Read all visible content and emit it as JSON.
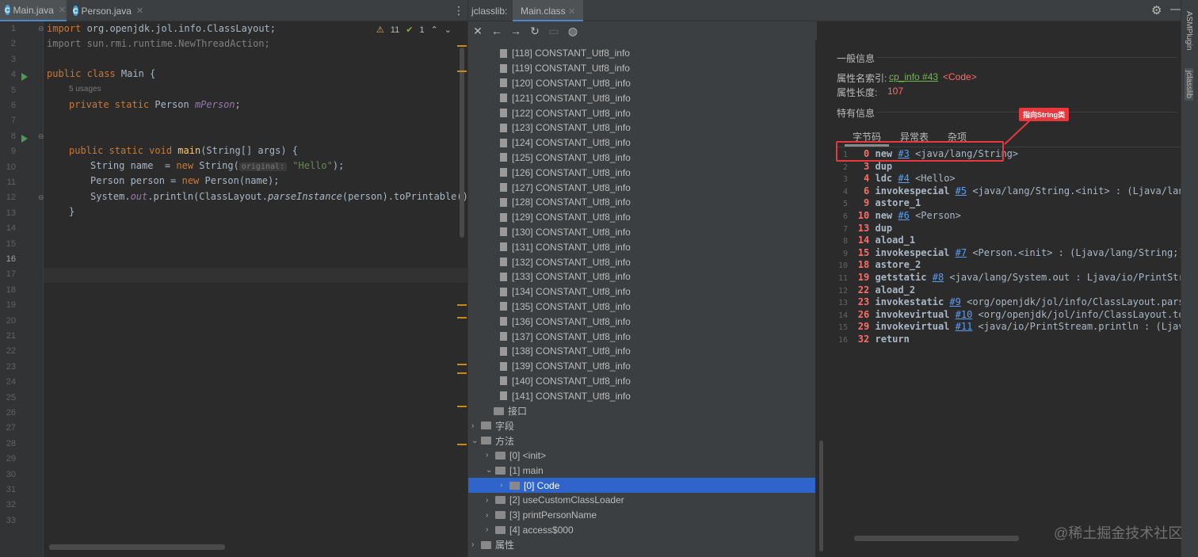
{
  "editor": {
    "tabs": [
      {
        "label": "Main.java",
        "icon": "java-class-icon"
      },
      {
        "label": "Person.java",
        "icon": "java-class-icon"
      }
    ],
    "inspection": {
      "warnings": "11",
      "ok": "1"
    },
    "line_numbers": [
      "1",
      "2",
      "3",
      "4",
      "5",
      "6",
      "7",
      "8",
      "9",
      "10",
      "11",
      "12",
      "13",
      "14",
      "15",
      "16",
      "17",
      "18",
      "19",
      "20",
      "21",
      "22",
      "23",
      "24",
      "25",
      "26",
      "27",
      "28",
      "29",
      "30",
      "31",
      "32",
      "33"
    ],
    "usages_hint": "5 usages",
    "param_hint": "original:",
    "code": {
      "l1_kw": "import",
      "l1_rest": " org.openjdk.jol.info.ClassLayout;",
      "l2": "import sun.rmi.runtime.NewThreadAction;",
      "l4_kw": "public class",
      "l4_rest": " Main {",
      "l5_kw": "private static",
      "l5_type": " Person ",
      "l5_field": "mPerson",
      "l5_end": ";",
      "l8_kw": "public static void",
      "l8_fn": "main",
      "l8_rest": "(String[] args) {",
      "l9_a": "String name  = ",
      "l9_kw": "new",
      "l9_b": " String(",
      "l9_str": "\"Hello\"",
      "l9_c": ");",
      "l10_a": "Person person = ",
      "l10_kw": "new",
      "l10_b": " Person(name);",
      "l11_a": "System.",
      "l11_out": "out",
      "l11_b": ".println(ClassLayout.",
      "l11_m": "parseInstance",
      "l11_c": "(person).toPrintable());",
      "l12": "}"
    }
  },
  "jclasslib": {
    "tool_title": "jclasslib:",
    "tab_label": "Main.class",
    "tree_constants": [
      "[118] CONSTANT_Utf8_info",
      "[119] CONSTANT_Utf8_info",
      "[120] CONSTANT_Utf8_info",
      "[121] CONSTANT_Utf8_info",
      "[122] CONSTANT_Utf8_info",
      "[123] CONSTANT_Utf8_info",
      "[124] CONSTANT_Utf8_info",
      "[125] CONSTANT_Utf8_info",
      "[126] CONSTANT_Utf8_info",
      "[127] CONSTANT_Utf8_info",
      "[128] CONSTANT_Utf8_info",
      "[129] CONSTANT_Utf8_info",
      "[130] CONSTANT_Utf8_info",
      "[131] CONSTANT_Utf8_info",
      "[132] CONSTANT_Utf8_info",
      "[133] CONSTANT_Utf8_info",
      "[134] CONSTANT_Utf8_info",
      "[135] CONSTANT_Utf8_info",
      "[136] CONSTANT_Utf8_info",
      "[137] CONSTANT_Utf8_info",
      "[138] CONSTANT_Utf8_info",
      "[139] CONSTANT_Utf8_info",
      "[140] CONSTANT_Utf8_info",
      "[141] CONSTANT_Utf8_info"
    ],
    "tree_nodes": {
      "interfaces": "接口",
      "fields": "字段",
      "methods": "方法",
      "m0": "[0] <init>",
      "m1": "[1] main",
      "code": "[0] Code",
      "m2": "[2] useCustomClassLoader",
      "m3": "[3] printPersonName",
      "m4": "[4] access$000",
      "attributes": "属性"
    },
    "detail": {
      "general_title": "一般信息",
      "attr_name_label": "属性名索引:",
      "attr_name_link": "cp_info #43",
      "attr_name_value": "<Code>",
      "attr_len_label": "属性长度:",
      "attr_len_value": "107",
      "specific_title": "特有信息",
      "subtabs": [
        "字节码",
        "异常表",
        "杂项"
      ],
      "callout": "指向String类"
    },
    "bytecode": [
      {
        "n": "1",
        "off": "0",
        "op": "new",
        "ref": "#3",
        "arg": "<java/lang/String>"
      },
      {
        "n": "2",
        "off": "3",
        "op": "dup",
        "ref": "",
        "arg": ""
      },
      {
        "n": "3",
        "off": "4",
        "op": "ldc",
        "ref": "#4",
        "arg": "<Hello>"
      },
      {
        "n": "4",
        "off": "6",
        "op": "invokespecial",
        "ref": "#5",
        "arg": "<java/lang/String.<init> : (Ljava/lang/Strin"
      },
      {
        "n": "5",
        "off": "9",
        "op": "astore_1",
        "ref": "",
        "arg": ""
      },
      {
        "n": "6",
        "off": "10",
        "op": "new",
        "ref": "#6",
        "arg": "<Person>"
      },
      {
        "n": "7",
        "off": "13",
        "op": "dup",
        "ref": "",
        "arg": ""
      },
      {
        "n": "8",
        "off": "14",
        "op": "aload_1",
        "ref": "",
        "arg": ""
      },
      {
        "n": "9",
        "off": "15",
        "op": "invokespecial",
        "ref": "#7",
        "arg": "<Person.<init> : (Ljava/lang/String;)V>"
      },
      {
        "n": "10",
        "off": "18",
        "op": "astore_2",
        "ref": "",
        "arg": ""
      },
      {
        "n": "11",
        "off": "19",
        "op": "getstatic",
        "ref": "#8",
        "arg": "<java/lang/System.out : Ljava/io/PrintStream;>"
      },
      {
        "n": "12",
        "off": "22",
        "op": "aload_2",
        "ref": "",
        "arg": ""
      },
      {
        "n": "13",
        "off": "23",
        "op": "invokestatic",
        "ref": "#9",
        "arg": "<org/openjdk/jol/info/ClassLayout.parseInstan"
      },
      {
        "n": "14",
        "off": "26",
        "op": "invokevirtual",
        "ref": "#10",
        "arg": "<org/openjdk/jol/info/ClassLayout.toPrintabl"
      },
      {
        "n": "15",
        "off": "29",
        "op": "invokevirtual",
        "ref": "#11",
        "arg": "<java/io/PrintStream.println : (Ljava/lang/"
      },
      {
        "n": "16",
        "off": "32",
        "op": "return",
        "ref": "",
        "arg": ""
      }
    ]
  },
  "side_strip": {
    "top": "ASMPlugin",
    "bottom": "jclasslib"
  },
  "watermark": "@稀土掘金技术社区",
  "colors": {
    "accent": "#2f65ca",
    "annotation_red": "#e8383d",
    "keyword": "#cc7832"
  }
}
